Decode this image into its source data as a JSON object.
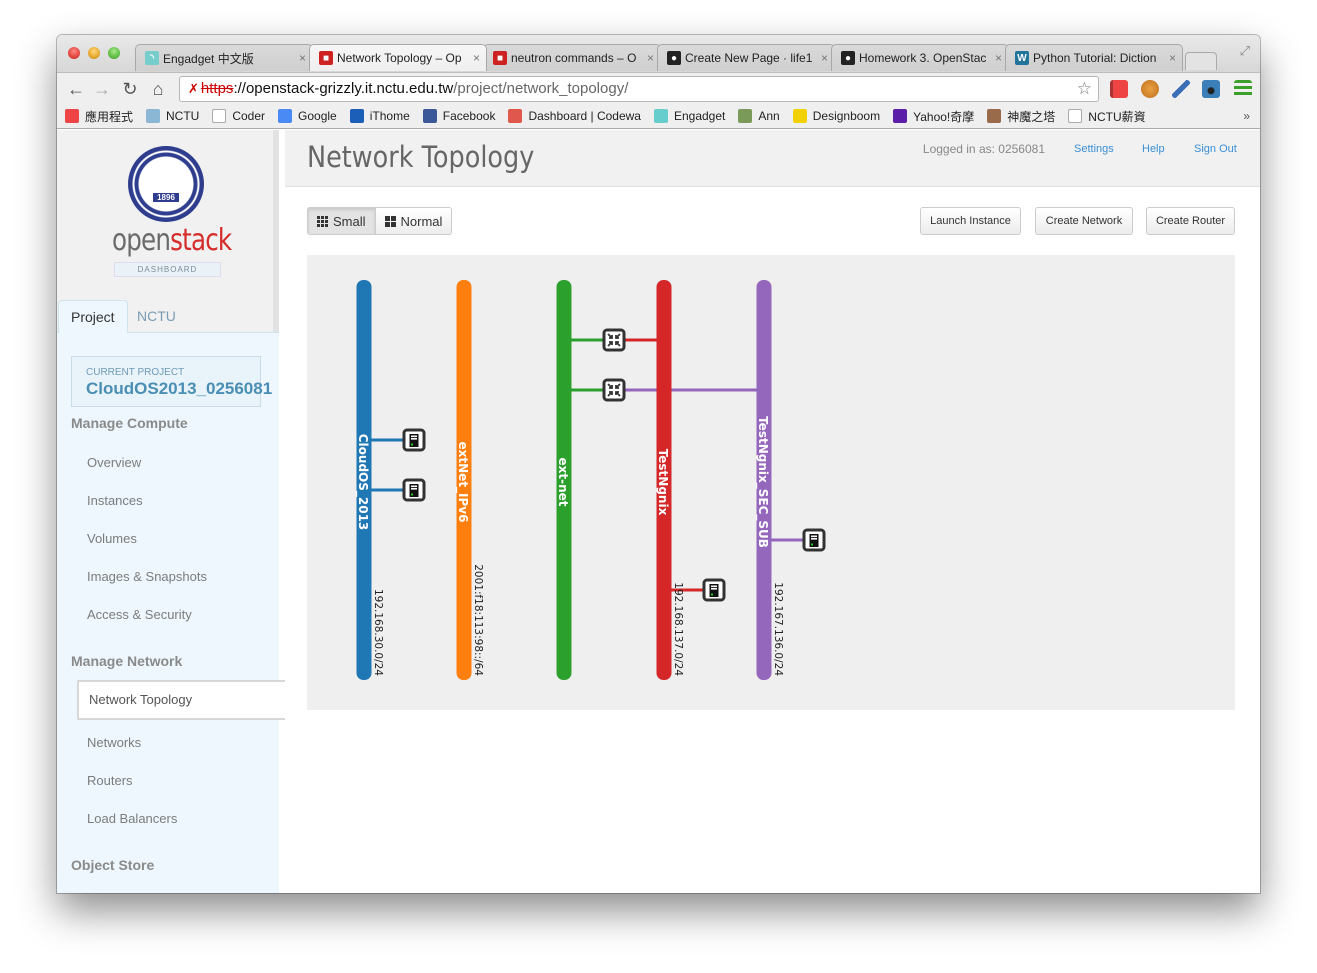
{
  "browser": {
    "tabs": [
      {
        "title": "Engadget 中文版",
        "icon": "rss-icon",
        "active": false
      },
      {
        "title": "Network Topology – Op",
        "icon": "openstack-icon",
        "active": true
      },
      {
        "title": "neutron commands – O",
        "icon": "openstack-icon",
        "active": false
      },
      {
        "title": "Create New Page · life1",
        "icon": "github-icon",
        "active": false
      },
      {
        "title": "Homework 3. OpenStac",
        "icon": "github-icon",
        "active": false
      },
      {
        "title": "Python Tutorial: Diction",
        "icon": "wordpress-icon",
        "active": false
      }
    ],
    "close_glyph": "×",
    "url": {
      "scheme": "https",
      "rest_host": "://openstack-grizzly.it.nctu.edu.tw",
      "path": "/project/network_topology/"
    },
    "bookmarks": [
      {
        "label": "應用程式",
        "icon": "apps-icon",
        "color": "#e44"
      },
      {
        "label": "NCTU",
        "icon": "folder-icon",
        "color": "#8bb6d4"
      },
      {
        "label": "Coder",
        "icon": "page-icon",
        "color": "#fff"
      },
      {
        "label": "Google",
        "icon": "google-icon",
        "color": "#4a8af4"
      },
      {
        "label": "iThome",
        "icon": "ithome-icon",
        "color": "#1b5fb8"
      },
      {
        "label": "Facebook",
        "icon": "facebook-icon",
        "color": "#3b5998"
      },
      {
        "label": "Dashboard | Codewa",
        "icon": "codewars-icon",
        "color": "#e0584d"
      },
      {
        "label": "Engadget",
        "icon": "rss-icon",
        "color": "#6cc"
      },
      {
        "label": "Ann",
        "icon": "image-icon",
        "color": "#7a9a5a"
      },
      {
        "label": "Designboom",
        "icon": "designboom-icon",
        "color": "#f2d100"
      },
      {
        "label": "Yahoo!奇摩",
        "icon": "yahoo-icon",
        "color": "#5b1ea6"
      },
      {
        "label": "神魔之塔",
        "icon": "game-icon",
        "color": "#9a6b4a"
      },
      {
        "label": "NCTU薪資",
        "icon": "page-icon",
        "color": "#fff"
      }
    ],
    "more_glyph": "»"
  },
  "sidebar": {
    "logo": {
      "open": "open",
      "stack": "stack",
      "dashboard": "DASHBOARD",
      "seal_year": "1896"
    },
    "tabs": [
      {
        "label": "Project",
        "active": true
      },
      {
        "label": "NCTU",
        "active": false
      }
    ],
    "current_project": {
      "label": "CURRENT PROJECT",
      "name": "CloudOS2013_0256081"
    },
    "sections": [
      {
        "heading": "Manage Compute",
        "items": [
          "Overview",
          "Instances",
          "Volumes",
          "Images & Snapshots",
          "Access & Security"
        ]
      },
      {
        "heading": "Manage Network",
        "items": [
          "Network Topology",
          "Networks",
          "Routers",
          "Load Balancers"
        ],
        "active_item": "Network Topology"
      },
      {
        "heading": "Object Store",
        "items": []
      }
    ]
  },
  "header": {
    "title": "Network Topology",
    "logged_in": "Logged in as: 0256081",
    "links": [
      "Settings",
      "Help",
      "Sign Out"
    ]
  },
  "toolbar": {
    "view_small": "Small",
    "view_normal": "Normal",
    "selected_view": "Small",
    "launch_instance": "Launch Instance",
    "create_network": "Create Network",
    "create_router": "Create Router"
  },
  "topology": {
    "networks": [
      {
        "name": "CloudOS_2013",
        "cidr": "192.168.30.0/24",
        "color": "#1f77b4"
      },
      {
        "name": "extNet_IPv6",
        "cidr": "2001:f18:113:98::/64",
        "color": "#ff7f0e"
      },
      {
        "name": "ext-net",
        "cidr": "",
        "color": "#2ca02c"
      },
      {
        "name": "TestNgnix",
        "cidr": "192.168.137.0/24",
        "color": "#d62728"
      },
      {
        "name": "TestNgnix_SEC_SUB",
        "cidr": "192.167.136.0/24",
        "color": "#9467bd"
      }
    ],
    "routers": [
      {
        "id": "router-1",
        "gateway": "ext-net",
        "interfaces": [
          "TestNgnix"
        ]
      },
      {
        "id": "router-2",
        "gateway": "ext-net",
        "interfaces": [
          "TestNgnix",
          "TestNgnix_SEC_SUB"
        ]
      }
    ],
    "instances": [
      {
        "network": "CloudOS_2013",
        "slot": 3
      },
      {
        "network": "CloudOS_2013",
        "slot": 4
      },
      {
        "network": "TestNgnix_SEC_SUB",
        "slot": 5
      },
      {
        "network": "TestNgnix",
        "slot": 6
      }
    ]
  }
}
